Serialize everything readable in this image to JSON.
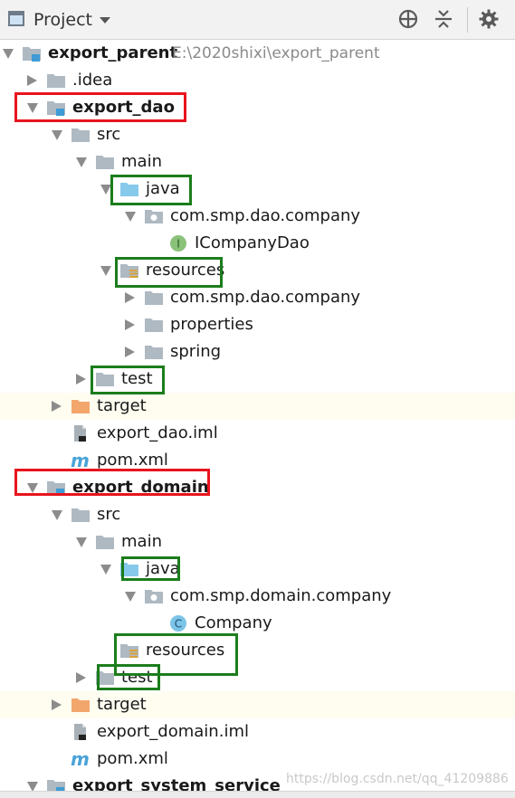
{
  "toolbar": {
    "title": "Project",
    "icons": [
      "project-window-icon",
      "chevron-down-icon",
      "locate-target-icon",
      "collapse-all-icon",
      "gear-icon"
    ]
  },
  "tree": [
    {
      "label": "export_parent",
      "path": "E:\\2020shixi\\export_parent",
      "icon": "module-folder-icon",
      "bold": true,
      "arrow": "down"
    },
    {
      "label": ".idea",
      "icon": "folder-icon",
      "arrow": "right"
    },
    {
      "label": "export_dao",
      "icon": "module-folder-icon",
      "bold": true,
      "arrow": "down"
    },
    {
      "label": "src",
      "icon": "folder-icon",
      "arrow": "down"
    },
    {
      "label": "main",
      "icon": "folder-icon",
      "arrow": "down"
    },
    {
      "label": "java",
      "icon": "source-root-folder-icon",
      "arrow": "down"
    },
    {
      "label": "com.smp.dao.company",
      "icon": "package-icon",
      "arrow": "down"
    },
    {
      "label": "ICompanyDao",
      "icon": "interface-icon"
    },
    {
      "label": "resources",
      "icon": "resources-folder-icon",
      "arrow": "down"
    },
    {
      "label": "com.smp.dao.company",
      "icon": "folder-icon",
      "arrow": "right"
    },
    {
      "label": "properties",
      "icon": "folder-icon",
      "arrow": "right"
    },
    {
      "label": "spring",
      "icon": "folder-icon",
      "arrow": "right"
    },
    {
      "label": "test",
      "icon": "folder-icon",
      "arrow": "right"
    },
    {
      "label": "target",
      "icon": "excluded-folder-icon",
      "arrow": "right",
      "highlight": true
    },
    {
      "label": "export_dao.iml",
      "icon": "iml-file-icon"
    },
    {
      "label": "pom.xml",
      "icon": "maven-icon"
    },
    {
      "label": "export_domain",
      "icon": "module-folder-icon",
      "bold": true,
      "arrow": "down"
    },
    {
      "label": "src",
      "icon": "folder-icon",
      "arrow": "down"
    },
    {
      "label": "main",
      "icon": "folder-icon",
      "arrow": "down"
    },
    {
      "label": "java",
      "icon": "source-root-folder-icon",
      "arrow": "down"
    },
    {
      "label": "com.smp.domain.company",
      "icon": "package-icon",
      "arrow": "down"
    },
    {
      "label": "Company",
      "icon": "class-icon"
    },
    {
      "label": "resources",
      "icon": "resources-folder-icon"
    },
    {
      "label": "test",
      "icon": "folder-icon",
      "arrow": "right"
    },
    {
      "label": "target",
      "icon": "excluded-folder-icon",
      "arrow": "right",
      "highlight": true
    },
    {
      "label": "export_domain.iml",
      "icon": "iml-file-icon"
    },
    {
      "label": "pom.xml",
      "icon": "maven-icon"
    },
    {
      "label": "export_system_service",
      "icon": "module-folder-icon",
      "bold": true,
      "arrow": "down"
    }
  ],
  "colors": {
    "folder": "#aeb9c2",
    "source_root": "#87c9ea",
    "excluded": "#f3a66b",
    "module_mark": "#3e9bd6",
    "red_box": "#e8141e",
    "green_box": "#1b7d1b"
  },
  "watermark": "https://blog.csdn.net/qq_41209886"
}
